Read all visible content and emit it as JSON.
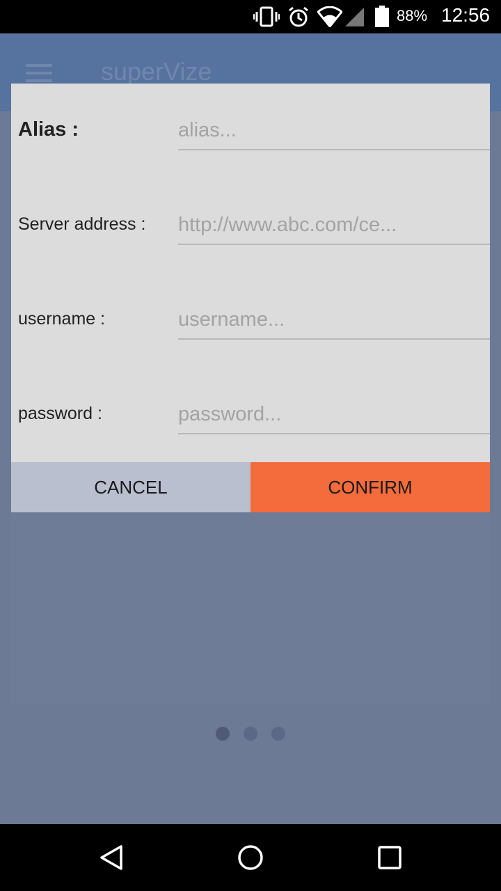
{
  "status_bar": {
    "battery_percent": "88%",
    "time": "12:56",
    "icons": [
      "vibrate-icon",
      "alarm-icon",
      "wifi-icon",
      "signal-icon",
      "battery-icon"
    ]
  },
  "app_bar": {
    "title": "superVize",
    "menu_icon": "hamburger-icon"
  },
  "dialog": {
    "fields": [
      {
        "label": "Alias :",
        "placeholder": "alias...",
        "value": ""
      },
      {
        "label": "Server address :",
        "placeholder": "http://www.abc.com/ce...",
        "value": ""
      },
      {
        "label": "username :",
        "placeholder": "username...",
        "value": ""
      },
      {
        "label": "password :",
        "placeholder": "password...",
        "value": ""
      }
    ],
    "cancel_label": "CANCEL",
    "confirm_label": "CONFIRM"
  },
  "pager": {
    "count": 3,
    "active_index": 0
  },
  "nav_bar": {
    "icons": [
      "back-icon",
      "home-icon",
      "recents-icon"
    ]
  },
  "colors": {
    "confirm_button": "#f46c3b",
    "cancel_button": "#b9bfcf",
    "dialog_background": "#dcdcdc",
    "scrim": "#6c7a96"
  }
}
